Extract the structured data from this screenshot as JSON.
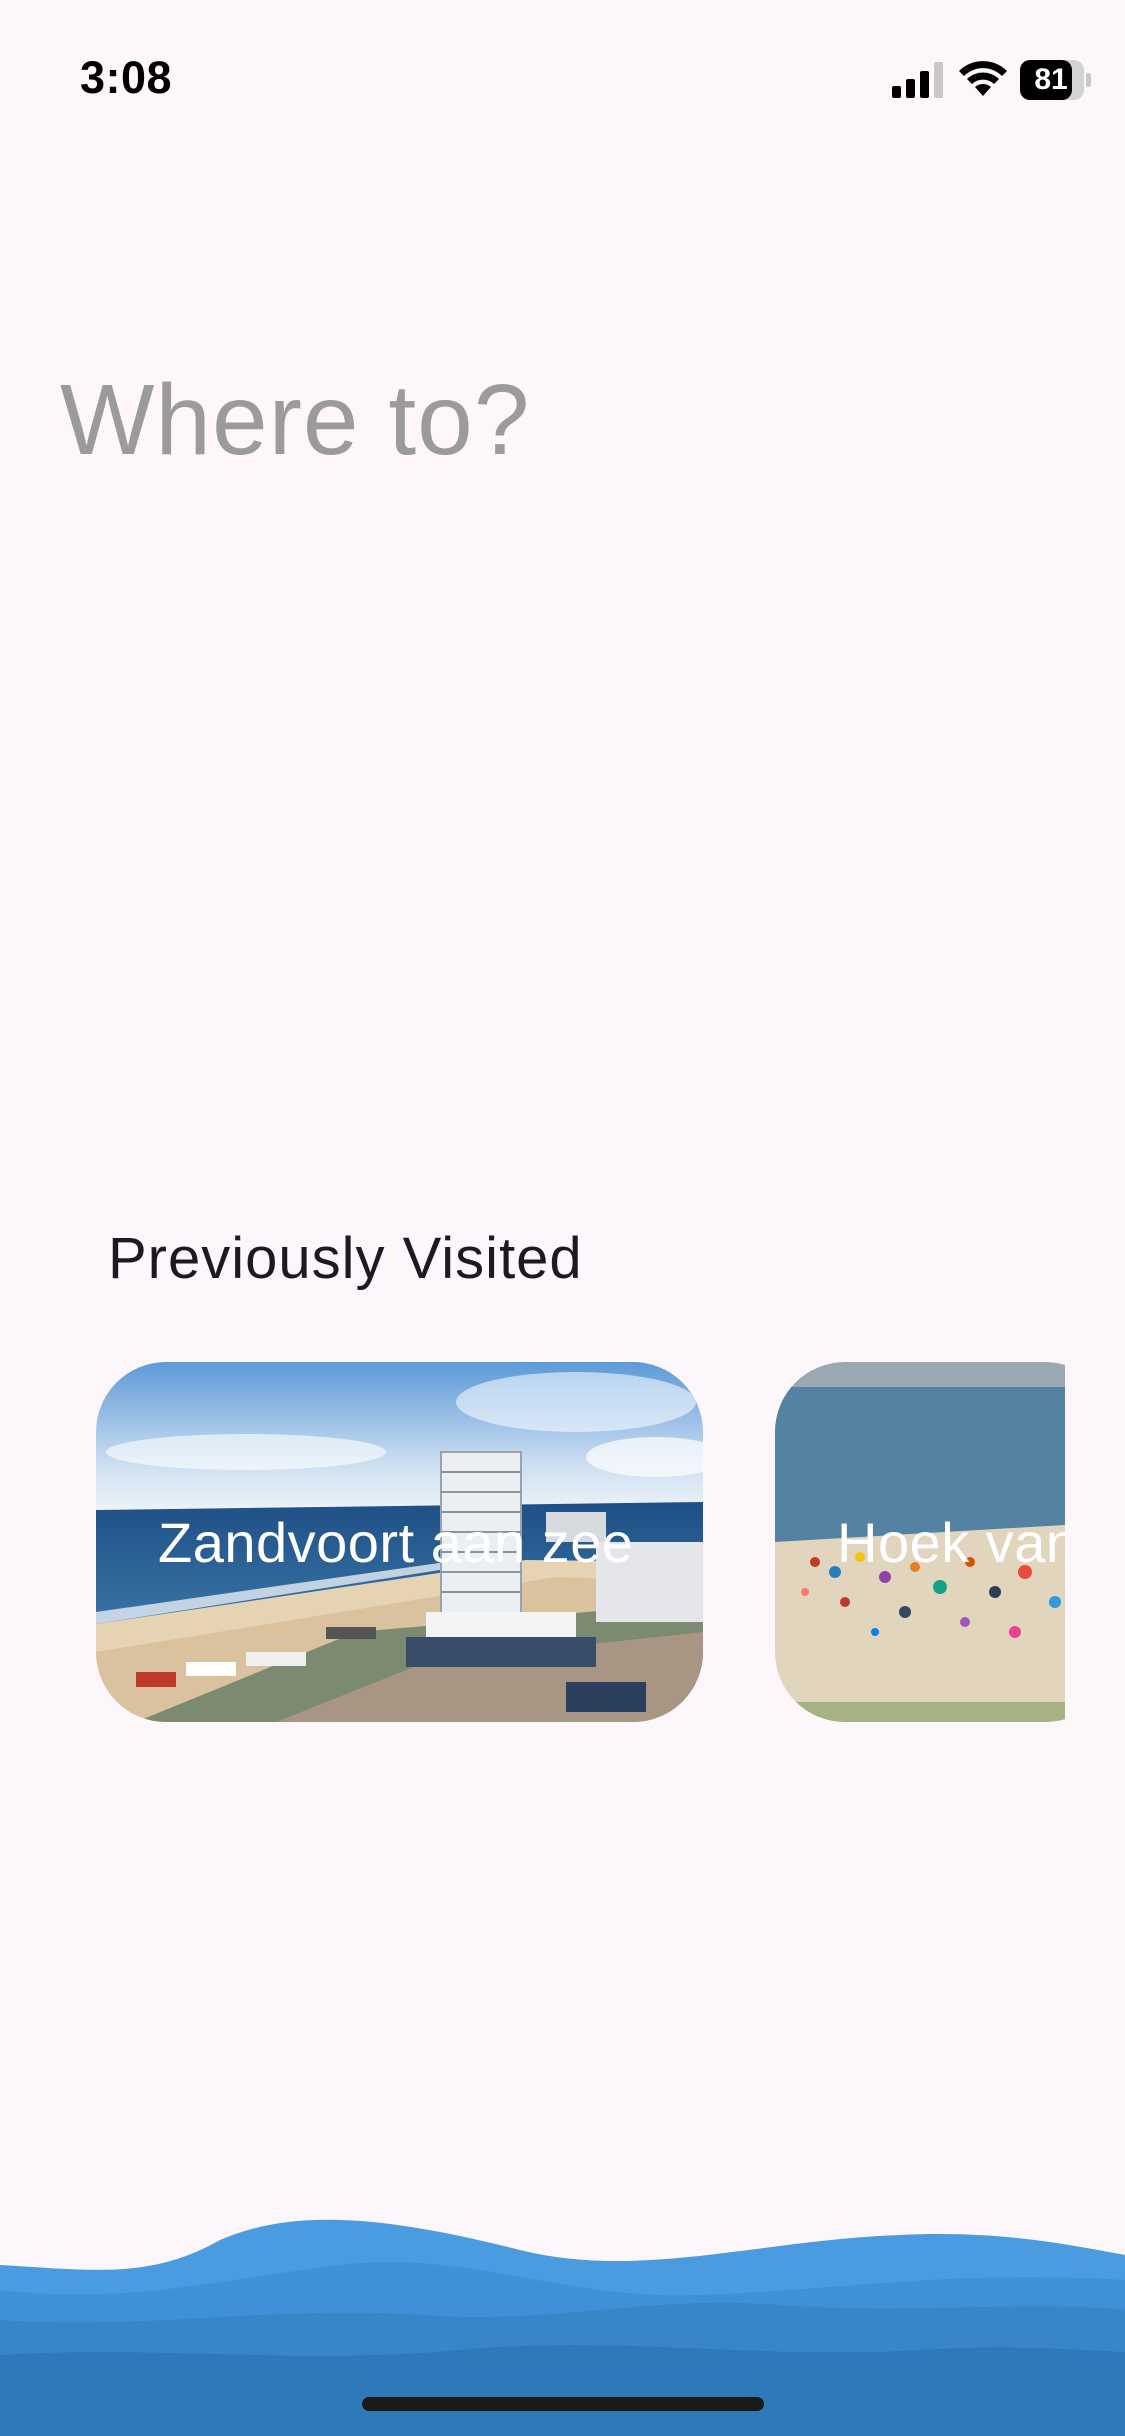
{
  "status_bar": {
    "time": "3:08",
    "battery_level": "81",
    "icons": [
      "signal-icon",
      "wifi-icon",
      "battery-icon"
    ]
  },
  "search": {
    "placeholder": "Where to?",
    "value": ""
  },
  "previously_visited": {
    "title": "Previously Visited",
    "cards": [
      {
        "label": "Zandvoort aan zee"
      },
      {
        "label": "Hoek van Holland"
      }
    ]
  },
  "colors": {
    "background": "#fdf7fc",
    "placeholder_text": "#9b9b9b",
    "wave_light": "#4a9be0",
    "wave_mid": "#3d8dd2",
    "wave_dark": "#2f78b8"
  }
}
